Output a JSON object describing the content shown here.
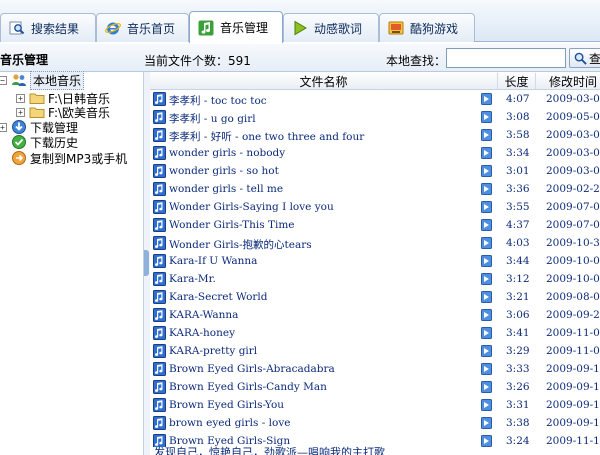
{
  "tabs": [
    {
      "label": "搜索结果",
      "icon": "search-icon"
    },
    {
      "label": "音乐首页",
      "icon": "ie-icon"
    },
    {
      "label": "音乐管理",
      "icon": "music-note-icon",
      "active": true
    },
    {
      "label": "动感歌词",
      "icon": "play-icon"
    },
    {
      "label": "酷狗游戏",
      "icon": "game-icon"
    }
  ],
  "header": {
    "title": "音乐管理",
    "file_count": "当前文件个数：591",
    "search_label": "本地查找：",
    "search_value": "",
    "search_button": "查"
  },
  "tree": {
    "local_music": "本地音乐",
    "folder_1": "F:\\日韩音乐",
    "folder_2": "F:\\欧美音乐",
    "download_mgmt": "下载管理",
    "download_history": "下载历史",
    "copy_to_mp3": "复制到MP3或手机"
  },
  "columns": {
    "name": "文件名称",
    "length": "长度",
    "modified": "修改时间"
  },
  "files": [
    {
      "name": "李孝利 - toc toc toc",
      "duration": "4:07",
      "modified": "2009-03-0"
    },
    {
      "name": "李孝利 - u go girl",
      "duration": "3:08",
      "modified": "2009-05-0"
    },
    {
      "name": "李孝利 - 好听 - one two three and four",
      "duration": "3:58",
      "modified": "2009-03-0"
    },
    {
      "name": "wonder girls - nobody",
      "duration": "3:34",
      "modified": "2009-03-0"
    },
    {
      "name": "wonder girls - so hot",
      "duration": "3:01",
      "modified": "2009-03-0"
    },
    {
      "name": "wonder girls - tell me",
      "duration": "3:36",
      "modified": "2009-02-2"
    },
    {
      "name": "Wonder Girls-Saying I love you",
      "duration": "3:55",
      "modified": "2009-07-0"
    },
    {
      "name": "Wonder Girls-This Time",
      "duration": "4:37",
      "modified": "2009-07-0"
    },
    {
      "name": "Wonder Girls-抱歉的心tears",
      "duration": "4:03",
      "modified": "2009-10-3"
    },
    {
      "name": "Kara-If U Wanna",
      "duration": "3:44",
      "modified": "2009-10-0"
    },
    {
      "name": "Kara-Mr.",
      "duration": "3:12",
      "modified": "2009-10-0"
    },
    {
      "name": "Kara-Secret World",
      "duration": "3:21",
      "modified": "2009-08-0"
    },
    {
      "name": "KARA-Wanna",
      "duration": "3:06",
      "modified": "2009-09-2"
    },
    {
      "name": "KARA-honey",
      "duration": "3:41",
      "modified": "2009-11-0"
    },
    {
      "name": "KARA-pretty girl",
      "duration": "3:29",
      "modified": "2009-11-0"
    },
    {
      "name": "Brown Eyed Girls-Abracadabra",
      "duration": "3:33",
      "modified": "2009-09-1"
    },
    {
      "name": "Brown Eyed Girls-Candy Man",
      "duration": "3:26",
      "modified": "2009-09-1"
    },
    {
      "name": "Brown Eyed Girls-You",
      "duration": "3:31",
      "modified": "2009-09-1"
    },
    {
      "name": "brown eyed girls - love",
      "duration": "3:38",
      "modified": "2009-09-1"
    },
    {
      "name": "Brown Eyed Girls-Sign",
      "duration": "3:24",
      "modified": "2009-11-1"
    }
  ],
  "marquee": "发现自己，惊艳自己，劲歌派—唱响我的主打歌",
  "colors": {
    "link_blue": "#0b2a7a",
    "tab_border": "#a9bdd6",
    "header_bg": "#e6eef7"
  }
}
